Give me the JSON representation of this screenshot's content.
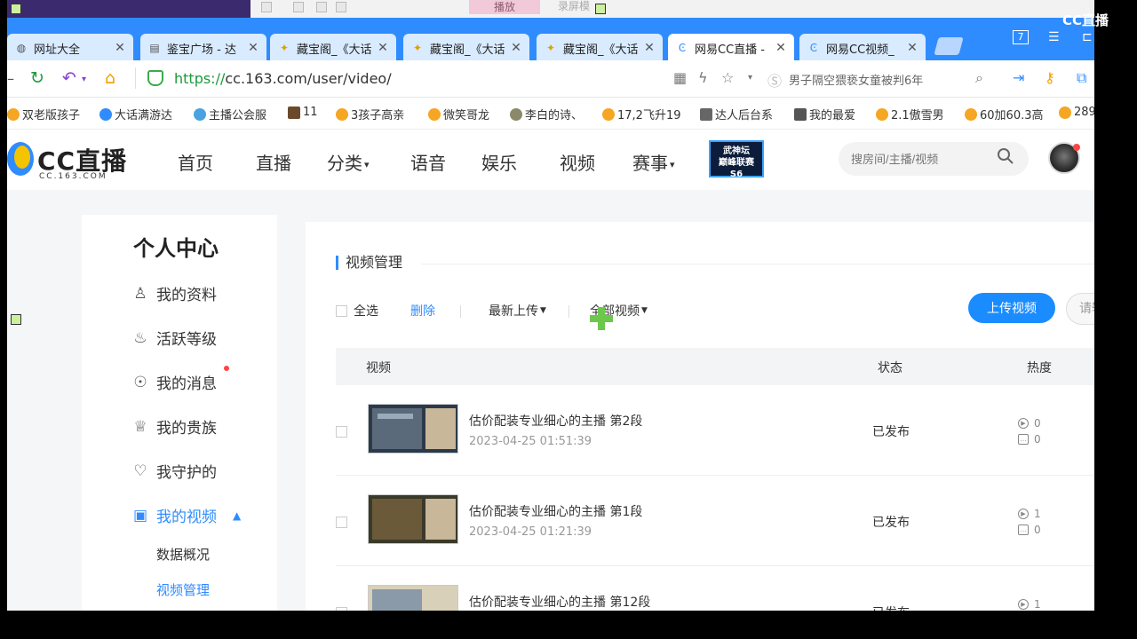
{
  "capture": {
    "play_label": "播放",
    "record_label": "录屏模"
  },
  "watermark": "CC直播",
  "tabs": [
    {
      "label": "网址大全",
      "icon": "globe-icon"
    },
    {
      "label": "鉴宝广场 - 达",
      "icon": "document-icon"
    },
    {
      "label": "藏宝阁_《大话",
      "icon": "cangbaoge-icon"
    },
    {
      "label": "藏宝阁_《大话",
      "icon": "cangbaoge-icon"
    },
    {
      "label": "藏宝阁_《大话",
      "icon": "cangbaoge-icon"
    },
    {
      "label": "网易CC直播 -",
      "icon": "cc-icon",
      "active": true
    },
    {
      "label": "网易CC视频_",
      "icon": "cc-icon"
    }
  ],
  "window_controls": {
    "badge": "7"
  },
  "address": {
    "protocol": "https://",
    "rest": "cc.163.com/user/video/",
    "search_hint": "男子隔空猥亵女童被判6年"
  },
  "bookmarks": [
    "双老版孩子",
    "大话满游达",
    "主播公会服",
    "11",
    "3孩子高亲",
    "微笑哥龙",
    "李白的诗、",
    "17,2飞升19",
    "达人后台系",
    "我的最爱",
    "2.1傲雪男",
    "60加60.3高",
    "289"
  ],
  "site": {
    "logo_text": "CC直播",
    "logo_sub": "CC.163.COM",
    "nav": [
      "首页",
      "直播",
      "分类",
      "语音",
      "娱乐",
      "视频",
      "赛事"
    ],
    "promo_lines": [
      "武神坛",
      "巅峰联赛",
      "S6"
    ],
    "search_placeholder": "搜房间/主播/视频"
  },
  "sidebar": {
    "title": "个人中心",
    "items": [
      {
        "label": "我的资料",
        "icon": "user-icon"
      },
      {
        "label": "活跃等级",
        "icon": "flame-icon"
      },
      {
        "label": "我的消息",
        "icon": "message-icon"
      },
      {
        "label": "我的贵族",
        "icon": "crown-icon"
      },
      {
        "label": "我守护的",
        "icon": "guard-icon"
      },
      {
        "label": "我的视频",
        "icon": "video-icon"
      }
    ],
    "subitems": [
      "数据概况",
      "视频管理"
    ]
  },
  "main": {
    "title": "视频管理",
    "select_all": "全选",
    "delete": "删除",
    "sort": "最新上传",
    "filter": "全部视频",
    "upload": "上传视频",
    "search_pill": "请输",
    "columns": {
      "video": "视频",
      "status": "状态",
      "heat": "热度"
    },
    "rows": [
      {
        "title": "估价配装专业细心的主播 第2段",
        "date": "2023-04-25 01:51:39",
        "status": "已发布",
        "plays": "0",
        "comments": "0"
      },
      {
        "title": "估价配装专业细心的主播 第1段",
        "date": "2023-04-25 01:21:39",
        "status": "已发布",
        "plays": "1",
        "comments": "0"
      },
      {
        "title": "估价配装专业细心的主播 第12段",
        "date": "",
        "status": "已发布",
        "plays": "1",
        "comments": ""
      }
    ]
  }
}
